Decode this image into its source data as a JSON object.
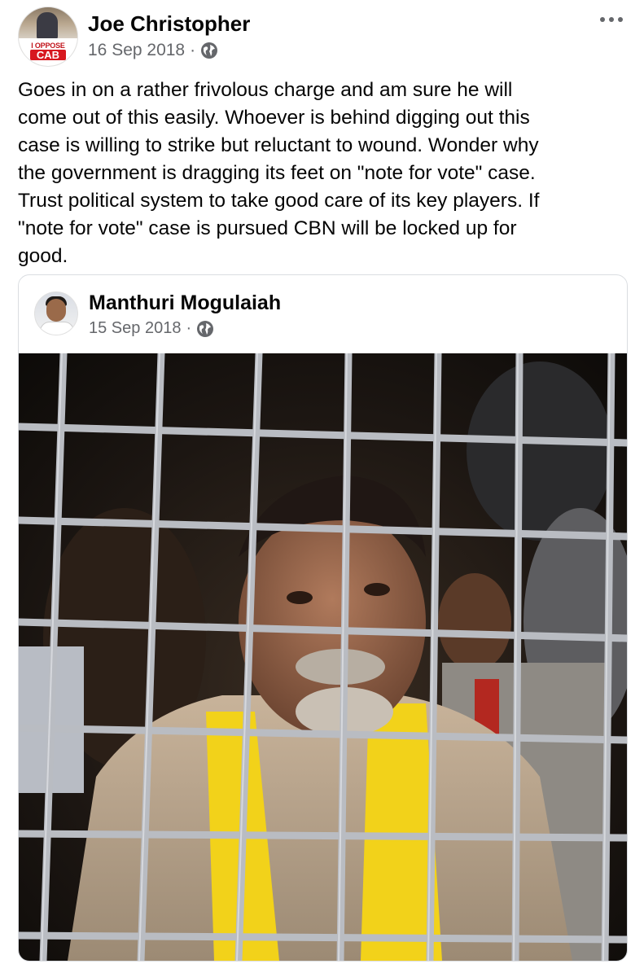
{
  "post": {
    "author": "Joe Christopher",
    "avatar_text_line1": "I OPPOSE",
    "avatar_text_line2": "CAB",
    "date": "16 Sep 2018",
    "separator": "·",
    "privacy_icon": "globe-icon",
    "more_icon": "more-dots-icon",
    "text": "Goes in on a rather frivolous charge and am sure he will\ncome out of this easily. Whoever is behind digging out this\ncase is willing to strike but reluctant to wound. Wonder why\nthe government is dragging its feet on \"note for vote\" case.\nTrust political system to take good care of its key players. If\n\"note for vote\" case is pursued CBN will be locked up for\ngood."
  },
  "shared_post": {
    "author": "Manthuri Mogulaiah",
    "date": "15 Sep 2018",
    "separator": "·",
    "privacy_icon": "globe-icon",
    "image_icon": "photo-man-behind-bars"
  },
  "colors": {
    "text": "#050505",
    "secondary": "#65676b",
    "border": "#dadde1",
    "scarf_yellow": "#f2d21a",
    "bars": "#b9bcc2"
  }
}
